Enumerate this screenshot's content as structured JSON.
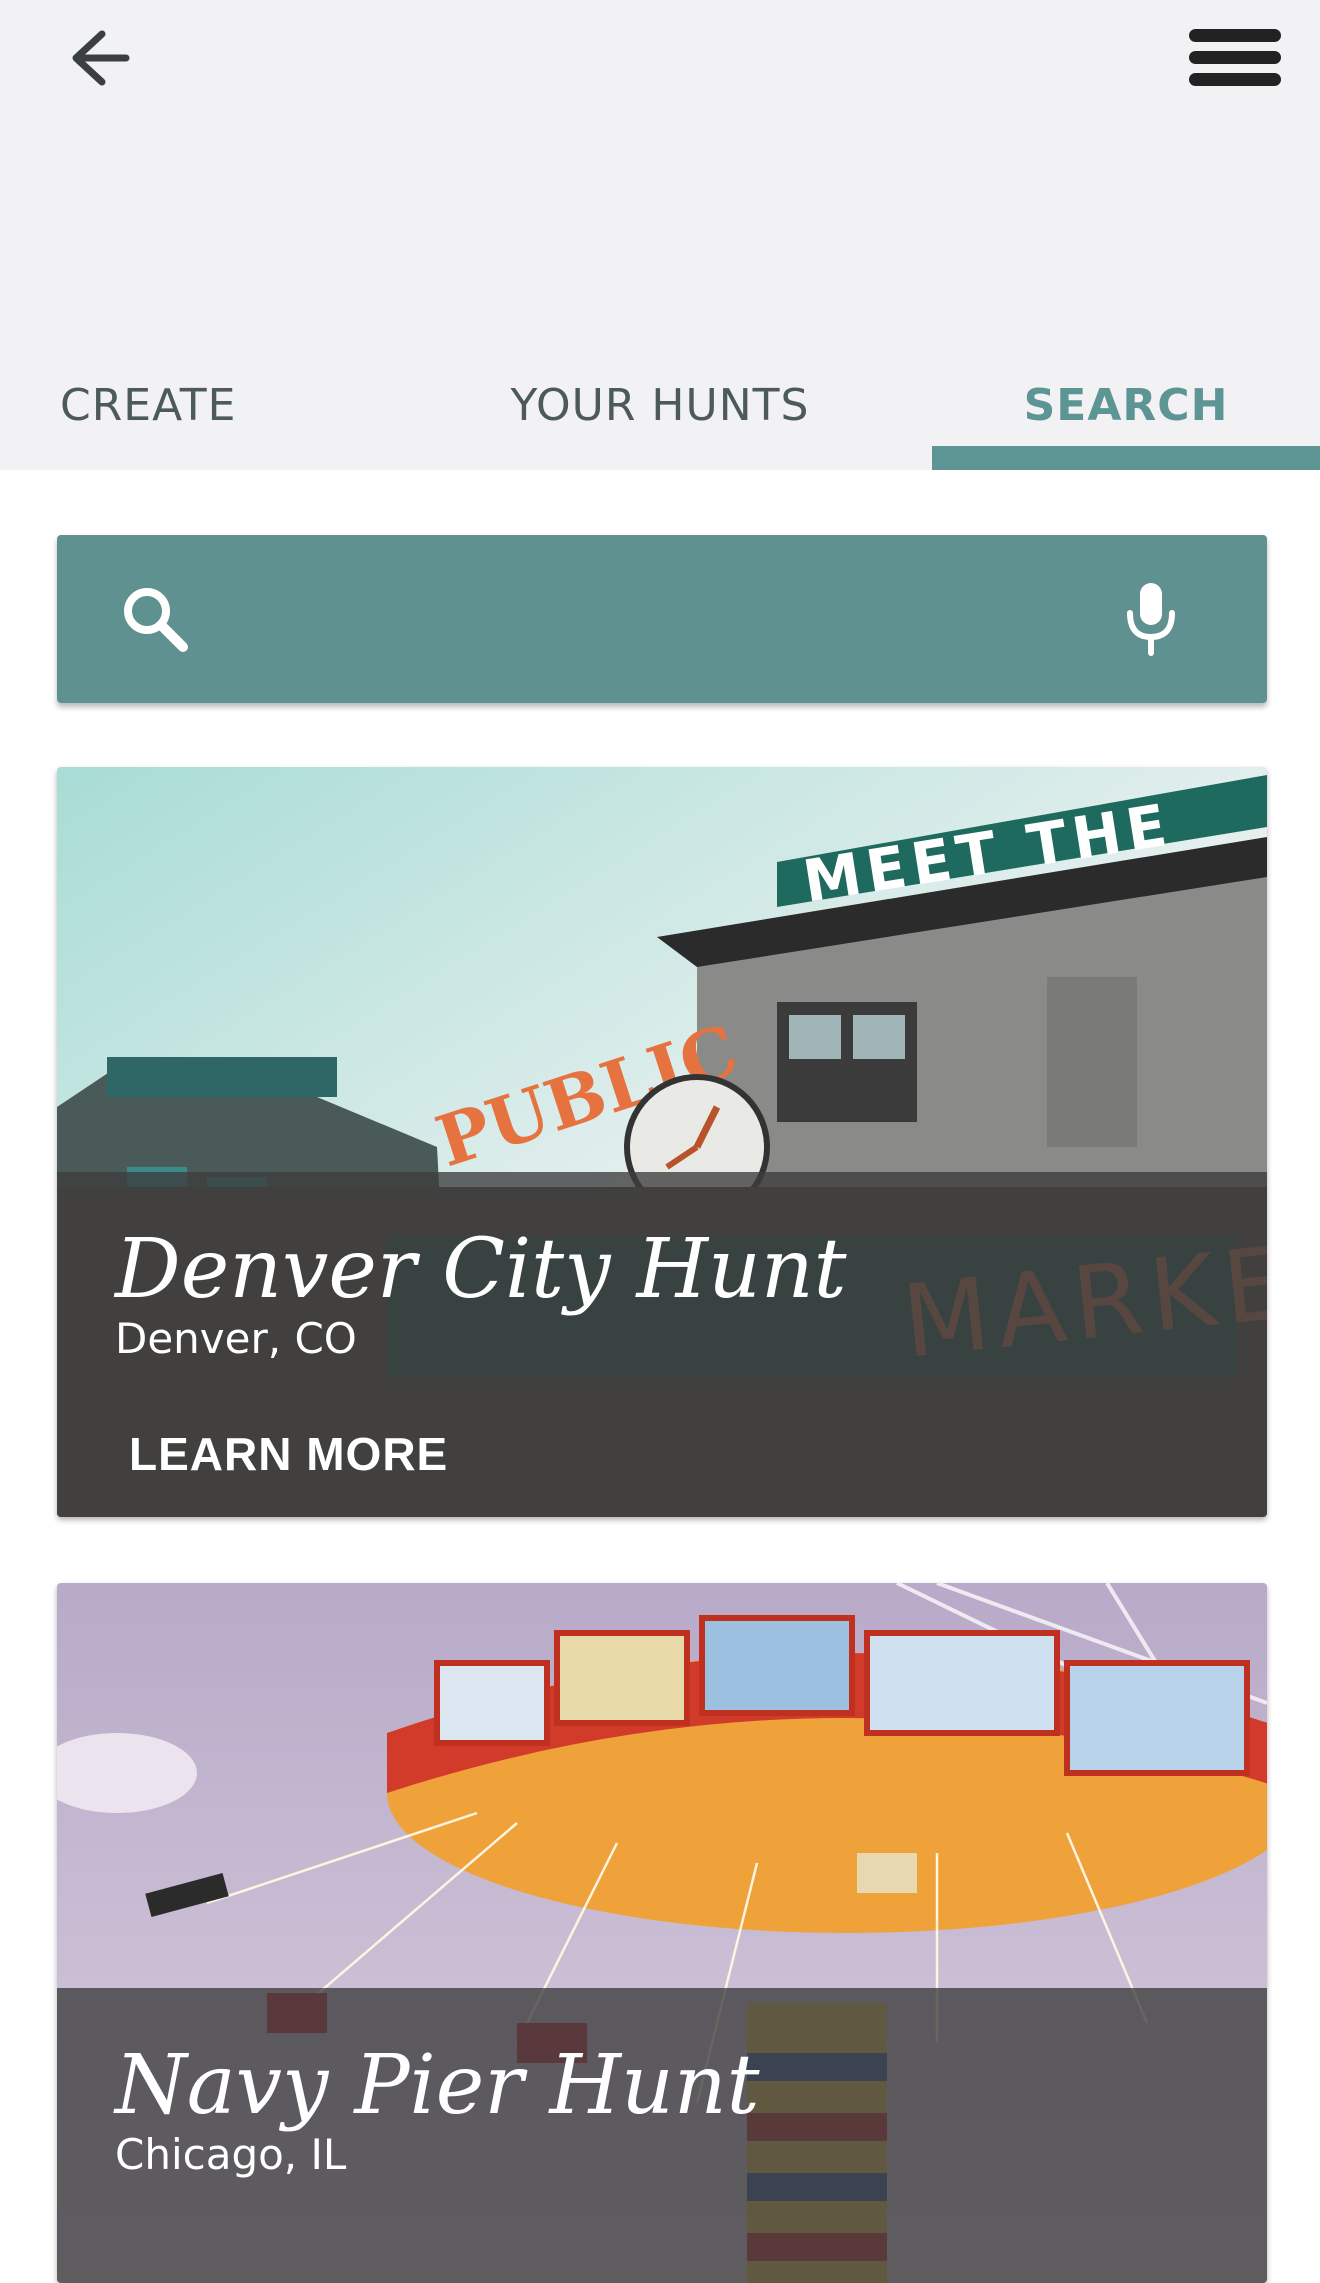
{
  "header": {
    "back_icon": "arrow-left-icon",
    "menu_icon": "hamburger-menu-icon"
  },
  "tabs": [
    {
      "label": "CREATE",
      "active": false
    },
    {
      "label": "YOUR HUNTS",
      "active": false
    },
    {
      "label": "SEARCH",
      "active": true
    }
  ],
  "search": {
    "value": "",
    "placeholder": "",
    "search_icon": "search-icon",
    "mic_icon": "microphone-icon"
  },
  "hunts": [
    {
      "title": "Denver City Hunt",
      "location": "Denver, CO",
      "action_label": "LEARN MORE"
    },
    {
      "title": "Navy Pier Hunt",
      "location": "Chicago, IL",
      "action_label": ""
    }
  ],
  "colors": {
    "accent": "#5c9593",
    "header_bg": "#f2f2f5",
    "tab_text": "#4d5a5a",
    "overlay": "#3c3c3c"
  }
}
